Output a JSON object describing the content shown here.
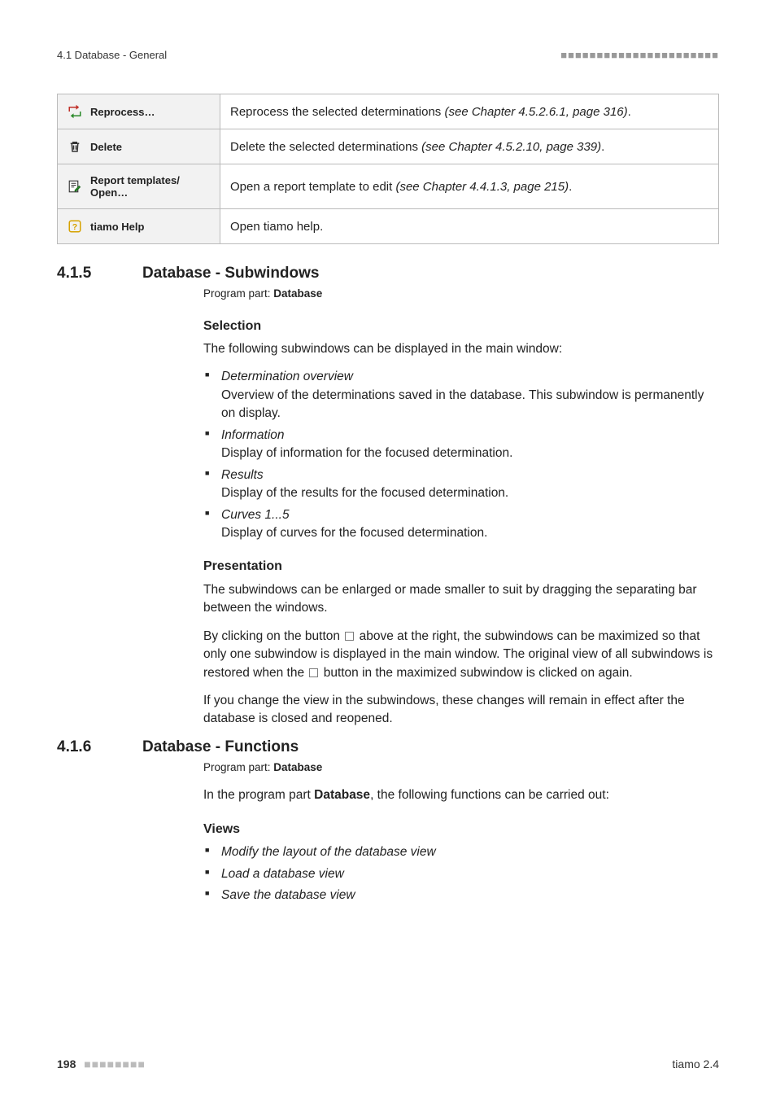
{
  "header": {
    "left": "4.1 Database - General",
    "right_dots": "■■■■■■■■■■■■■■■■■■■■■■"
  },
  "table_rows": [
    {
      "icon": "reprocess",
      "label": "Reprocess…",
      "desc_pre": "Reprocess the selected determinations ",
      "desc_emph": "(see Chapter 4.5.2.6.1, page 316)",
      "desc_post": "."
    },
    {
      "icon": "delete",
      "label": "Delete",
      "desc_pre": "Delete the selected determinations ",
      "desc_emph": "(see Chapter 4.5.2.10, page 339)",
      "desc_post": "."
    },
    {
      "icon": "report",
      "label": "Report templates/\nOpen…",
      "desc_pre": "Open a report template to edit ",
      "desc_emph": "(see Chapter 4.4.1.3, page 215)",
      "desc_post": "."
    },
    {
      "icon": "help",
      "label": "tiamo Help",
      "desc_pre": "Open tiamo help.",
      "desc_emph": "",
      "desc_post": ""
    }
  ],
  "s415": {
    "num": "4.1.5",
    "title": "Database - Subwindows",
    "program_part_label": "Program part: ",
    "program_part_value": "Database",
    "selection_h": "Selection",
    "selection_intro": "The following subwindows can be displayed in the main window:",
    "items": [
      {
        "t": "Determination overview",
        "d": "Overview of the determinations saved in the database. This subwindow is permanently on display."
      },
      {
        "t": "Information",
        "d": "Display of information for the focused determination."
      },
      {
        "t": "Results",
        "d": "Display of the results for the focused determination."
      },
      {
        "t": "Curves 1...5",
        "d": "Display of curves for the focused determination."
      }
    ],
    "presentation_h": "Presentation",
    "presentation_p1": "The subwindows can be enlarged or made smaller to suit by dragging the separating bar between the windows.",
    "presentation_p2a": "By clicking on the button ",
    "presentation_p2b": " above at the right, the subwindows can be maximized so that only one subwindow is displayed in the main window. The original view of all subwindows is restored when the ",
    "presentation_p2c": " button in the maximized subwindow is clicked on again.",
    "presentation_p3": "If you change the view in the subwindows, these changes will remain in effect after the database is closed and reopened."
  },
  "s416": {
    "num": "4.1.6",
    "title": "Database - Functions",
    "program_part_label": "Program part: ",
    "program_part_value": "Database",
    "intro_a": "In the program part ",
    "intro_b": "Database",
    "intro_c": ", the following functions can be carried out:",
    "views_h": "Views",
    "items": [
      "Modify the layout of the database view",
      "Load a database view",
      "Save the database view"
    ]
  },
  "footer": {
    "page": "198",
    "page_dots": "■■■■■■■■",
    "right": "tiamo 2.4"
  }
}
